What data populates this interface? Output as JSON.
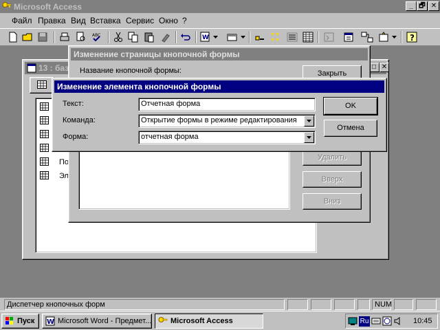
{
  "app": {
    "title": "Microsoft Access",
    "caption_buttons": [
      "_",
      "🗗",
      "✕"
    ],
    "menu": [
      "Файл",
      "Правка",
      "Вид",
      "Вставка",
      "Сервис",
      "Окно",
      "?"
    ]
  },
  "db_window": {
    "title": "13 : баз",
    "items": [
      "",
      "",
      "",
      "",
      "Пок",
      "Эле"
    ]
  },
  "page_dialog": {
    "title": "Изменение страницы кнопочной формы",
    "name_label": "Название кнопочной формы:",
    "buttons": {
      "close": "Закрыть",
      "delete": "Удалить",
      "up": "Вверх",
      "down": "Вниз"
    }
  },
  "item_dialog": {
    "title": "Изменение элемента кнопочной формы",
    "text_label": "Текст:",
    "text_value": "Отчетная форма",
    "command_label": "Команда:",
    "command_value": "Открытие формы в режиме редактирования",
    "form_label": "Форма:",
    "form_value": "отчетная форма",
    "ok": "OK",
    "cancel": "Отмена"
  },
  "statusbar": {
    "text": "Диспетчер кнопочных форм",
    "num": "NUM"
  },
  "taskbar": {
    "start": "Пуск",
    "tasks": [
      "Microsoft Word - Предмет...",
      "Microsoft Access"
    ],
    "clock": "10:45",
    "lang": "Ru"
  }
}
